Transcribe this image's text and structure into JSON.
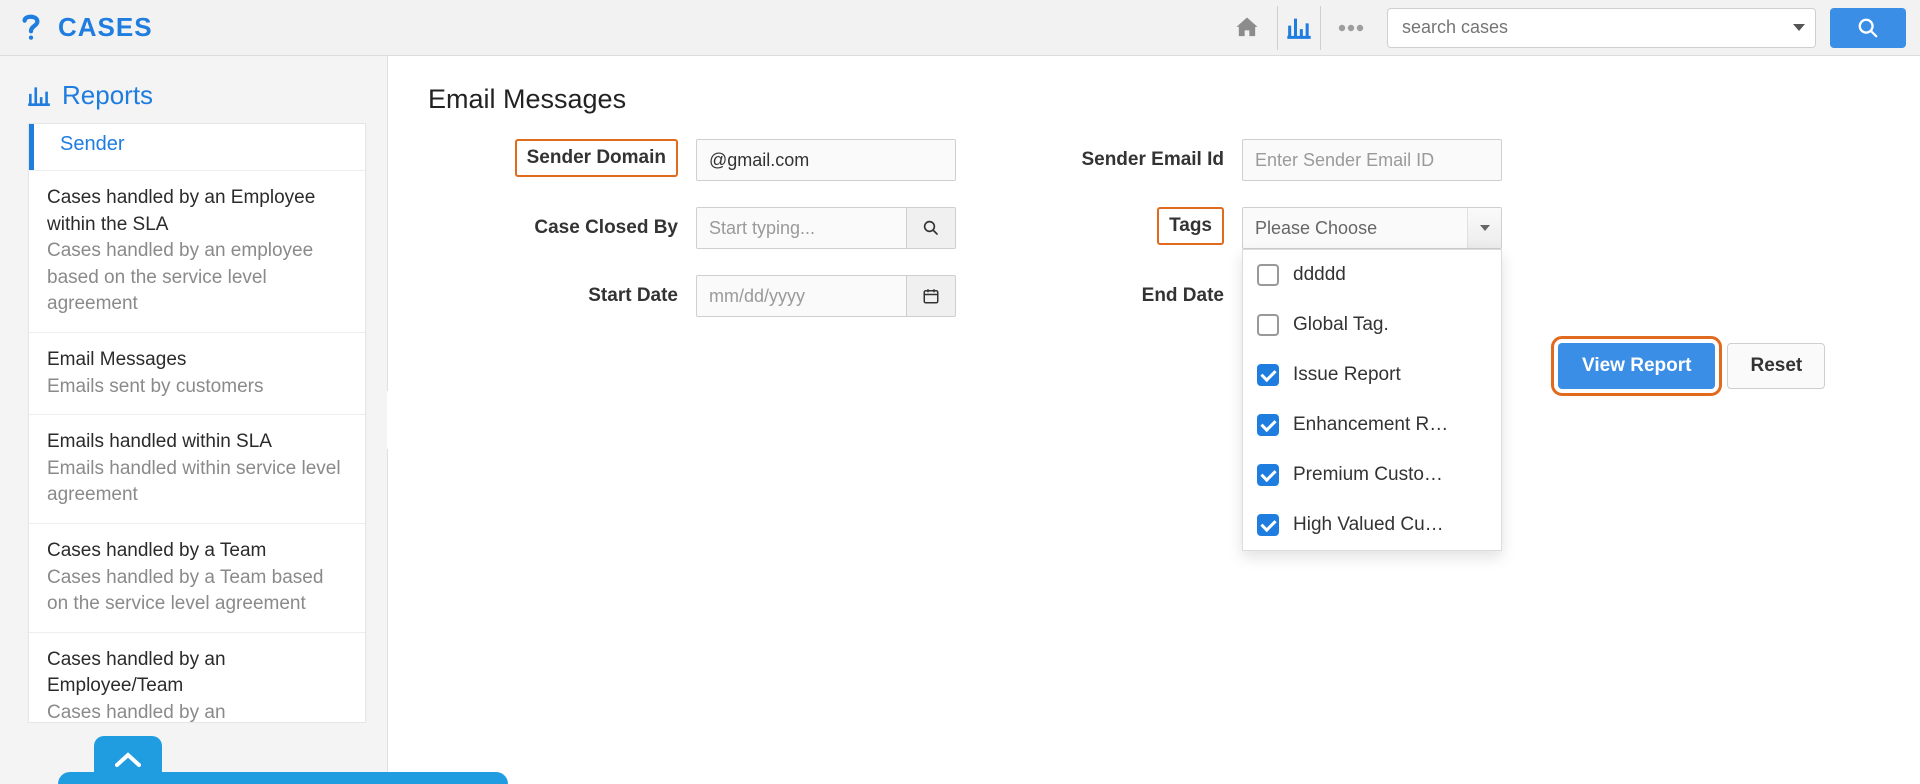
{
  "brand": {
    "name": "CASES"
  },
  "search": {
    "placeholder": "search cases"
  },
  "sidebar": {
    "heading": "Reports",
    "partial_top": "Sender",
    "items": [
      {
        "title": "Cases handled by an Employee within the SLA",
        "desc": "Cases handled by an employee based on the service level agreement"
      },
      {
        "title": "Email Messages",
        "desc": "Emails sent by customers"
      },
      {
        "title": "Emails handled within SLA",
        "desc": "Emails handled within service level agreement"
      },
      {
        "title": "Cases handled by a Team",
        "desc": "Cases handled by a Team based on the service level agreement"
      },
      {
        "title": "Cases handled by an Employee/Team",
        "desc": "Cases handled by an"
      }
    ]
  },
  "page": {
    "title": "Email Messages"
  },
  "form": {
    "sender_domain": {
      "label": "Sender Domain",
      "value": "@gmail.com"
    },
    "sender_email": {
      "label": "Sender Email Id",
      "placeholder": "Enter Sender Email ID"
    },
    "case_closed": {
      "label": "Case Closed By",
      "placeholder": "Start typing..."
    },
    "tags": {
      "label": "Tags",
      "placeholder": "Please Choose",
      "options": [
        {
          "label": "ddddd",
          "checked": false
        },
        {
          "label": "Global Tag.",
          "checked": false
        },
        {
          "label": "Issue Report",
          "checked": true
        },
        {
          "label": "Enhancement R…",
          "checked": true
        },
        {
          "label": "Premium Custo…",
          "checked": true
        },
        {
          "label": "High Valued Cu…",
          "checked": true
        }
      ]
    },
    "start_date": {
      "label": "Start Date",
      "placeholder": "mm/dd/yyyy"
    },
    "end_date": {
      "label": "End Date"
    }
  },
  "buttons": {
    "view_report": "View Report",
    "reset": "Reset"
  }
}
